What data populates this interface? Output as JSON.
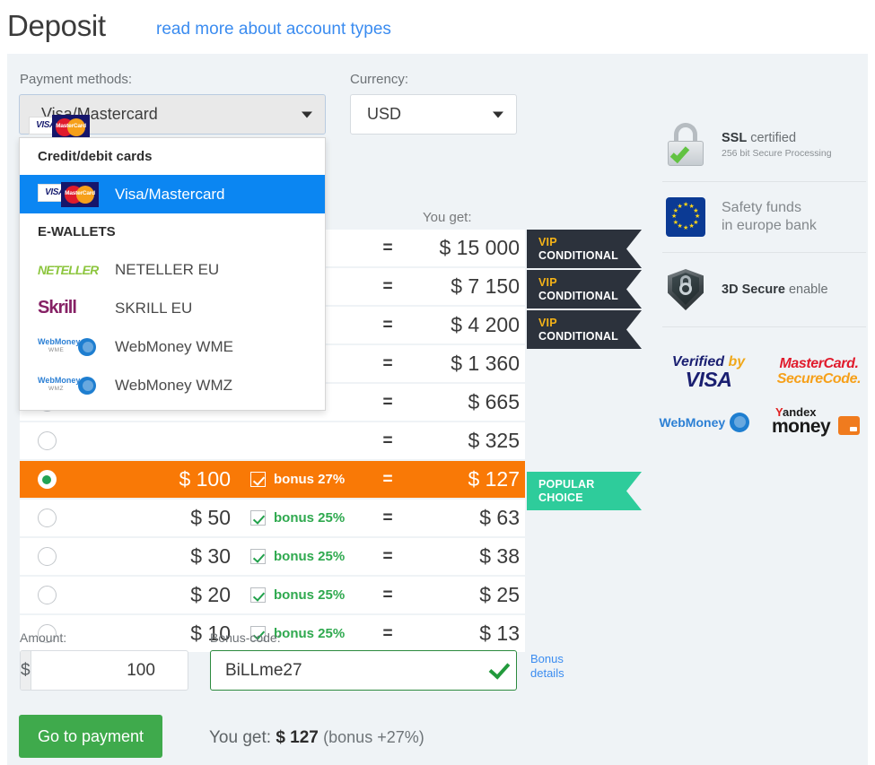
{
  "header": {
    "title": "Deposit",
    "link": "read more about account types"
  },
  "form": {
    "payment_label": "Payment methods:",
    "currency_label": "Currency:",
    "payment_selected": "Visa/Mastercard",
    "currency_selected": "USD",
    "you_get_label": "You get:"
  },
  "dropdown": {
    "groups": [
      {
        "title": "Credit/debit cards",
        "items": [
          {
            "label": "Visa/Mastercard",
            "logo": "visa-mastercard-logo",
            "selected": true
          }
        ]
      },
      {
        "title": "E-WALLETS",
        "items": [
          {
            "label": "NETELLER EU",
            "logo": "neteller-logo",
            "selected": false
          },
          {
            "label": "SKRILL EU",
            "logo": "skrill-logo",
            "selected": false
          },
          {
            "label": "WebMoney WME",
            "logo": "webmoney-wme-logo",
            "selected": false
          },
          {
            "label": "WebMoney WMZ",
            "logo": "webmoney-wmz-logo",
            "selected": false
          }
        ]
      }
    ]
  },
  "rows": [
    {
      "amount": "",
      "bonus": "",
      "eq": "=",
      "get": "$ 15 000",
      "badge_l1": "VIP",
      "badge_l2": "CONDITIONAL",
      "badge_type": "vip",
      "active": false,
      "obscured": true
    },
    {
      "amount": "",
      "bonus": "",
      "eq": "=",
      "get": "$ 7 150",
      "badge_l1": "VIP",
      "badge_l2": "CONDITIONAL",
      "badge_type": "vip",
      "active": false,
      "obscured": true
    },
    {
      "amount": "",
      "bonus": "",
      "eq": "=",
      "get": "$ 4 200",
      "badge_l1": "VIP",
      "badge_l2": "CONDITIONAL",
      "badge_type": "vip",
      "active": false,
      "obscured": true
    },
    {
      "amount": "",
      "bonus": "",
      "eq": "=",
      "get": "$ 1 360",
      "badge_l1": "",
      "badge_l2": "",
      "badge_type": "",
      "active": false,
      "obscured": true
    },
    {
      "amount": "",
      "bonus": "",
      "eq": "=",
      "get": "$ 665",
      "badge_l1": "",
      "badge_l2": "",
      "badge_type": "",
      "active": false,
      "obscured": true
    },
    {
      "amount": "",
      "bonus": "",
      "eq": "=",
      "get": "$ 325",
      "badge_l1": "",
      "badge_l2": "",
      "badge_type": "",
      "active": false,
      "obscured": true
    },
    {
      "amount": "$ 100",
      "bonus": "bonus 27%",
      "eq": "=",
      "get": "$ 127",
      "badge_l1": "POPULAR",
      "badge_l2": "CHOICE",
      "badge_type": "popular",
      "active": true,
      "obscured": false
    },
    {
      "amount": "$ 50",
      "bonus": "bonus 25%",
      "eq": "=",
      "get": "$ 63",
      "badge_l1": "",
      "badge_l2": "",
      "badge_type": "",
      "active": false,
      "obscured": false
    },
    {
      "amount": "$ 30",
      "bonus": "bonus 25%",
      "eq": "=",
      "get": "$ 38",
      "badge_l1": "",
      "badge_l2": "",
      "badge_type": "",
      "active": false,
      "obscured": false
    },
    {
      "amount": "$ 20",
      "bonus": "bonus 25%",
      "eq": "=",
      "get": "$ 25",
      "badge_l1": "",
      "badge_l2": "",
      "badge_type": "",
      "active": false,
      "obscured": false
    },
    {
      "amount": "$ 10",
      "bonus": "bonus 25%",
      "eq": "=",
      "get": "$ 13",
      "badge_l1": "",
      "badge_l2": "",
      "badge_type": "",
      "active": false,
      "obscured": false
    }
  ],
  "bottom": {
    "amount_label": "Amount:",
    "amount_prefix": "$",
    "amount_value": "100",
    "bonus_label": "Bonus-code:",
    "bonus_value": "BiLLme27",
    "bonus_details_l1": "Bonus",
    "bonus_details_l2": "details",
    "pay_button": "Go to payment",
    "summary_prefix": "You get:",
    "summary_amount": "$ 127",
    "summary_bonus": "(bonus +27%)"
  },
  "sidebar": {
    "items": [
      {
        "icon": "lock-icon",
        "title_bold": "SSL",
        "title_rest": " certified",
        "sub": "256 bit Secure Processing"
      },
      {
        "icon": "eu-flag-icon",
        "line1": "Safety funds",
        "line2": "in europe bank"
      },
      {
        "icon": "shield-icon",
        "title_bold": "3D Secure",
        "title_rest": " enable"
      }
    ],
    "brands": [
      {
        "name": "verified-by-visa-logo",
        "l1": "Verified",
        "l1b": "by",
        "l2": "VISA"
      },
      {
        "name": "mastercard-securecode-logo",
        "l1": "MasterCard.",
        "l2": "SecureCode."
      },
      {
        "name": "webmoney-logo",
        "text": "WebMoney"
      },
      {
        "name": "yandex-money-logo",
        "y1a": "Y",
        "y1b": "andex",
        "y2": "money"
      }
    ]
  },
  "colors": {
    "accent_orange": "#f97906",
    "green": "#3faa4c",
    "link_blue": "#3b8cf0",
    "panel_bg": "#eff3f6",
    "vip_badge": "#2c323c",
    "popular_badge": "#2ecc9b"
  }
}
